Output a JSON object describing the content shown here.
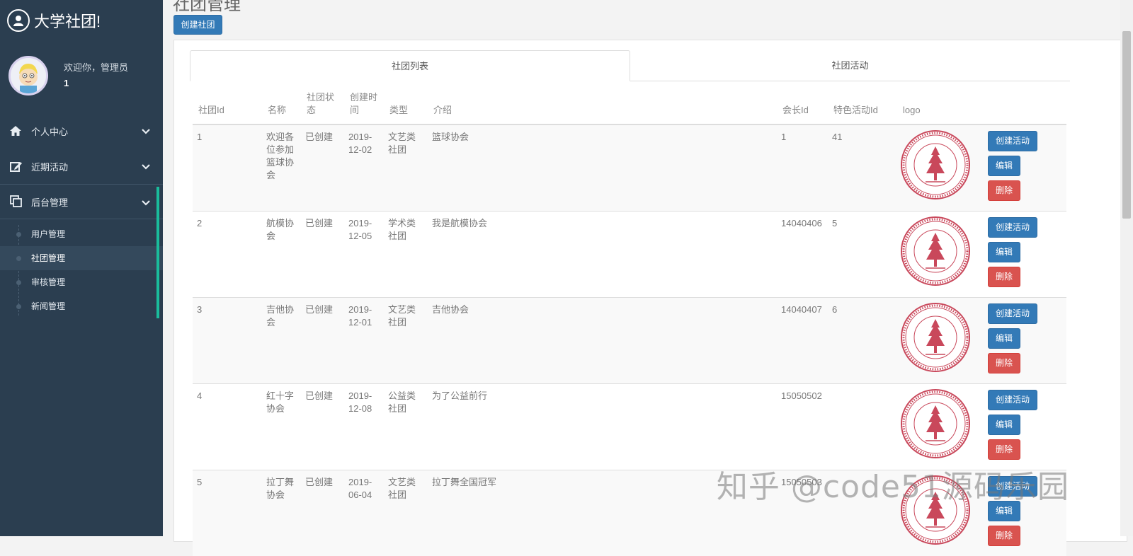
{
  "brand": {
    "title": "大学社团!"
  },
  "user": {
    "welcome": "欢迎你，管理员",
    "id": "1"
  },
  "menu": [
    {
      "label": "个人中心",
      "icon": "home-icon"
    },
    {
      "label": "近期活动",
      "icon": "edit-icon"
    },
    {
      "label": "后台管理",
      "icon": "copy-icon"
    }
  ],
  "submenu": [
    "用户管理",
    "社团管理",
    "审核管理",
    "新闻管理"
  ],
  "page": {
    "title": "社团管理",
    "create_button": "创建社团"
  },
  "tabs": {
    "list": "社团列表",
    "activities": "社团活动"
  },
  "table": {
    "headers": [
      "社团Id",
      "名称",
      "社团状态",
      "创建时间",
      "类型",
      "介绍",
      "会长Id",
      "特色活动Id",
      "logo"
    ],
    "rows": [
      {
        "id": "1",
        "name": "欢迎各位参加篮球协会",
        "status": "已创建",
        "created": "2019-12-02",
        "type": "文艺类社团",
        "intro": "篮球协会",
        "president": "1",
        "activity": "41"
      },
      {
        "id": "2",
        "name": "航模协会",
        "status": "已创建",
        "created": "2019-12-05",
        "type": "学术类社团",
        "intro": "我是航模协会",
        "president": "14040406",
        "activity": "5"
      },
      {
        "id": "3",
        "name": "吉他协会",
        "status": "已创建",
        "created": "2019-12-01",
        "type": "文艺类社团",
        "intro": "吉他协会",
        "president": "14040407",
        "activity": "6"
      },
      {
        "id": "4",
        "name": "红十字协会",
        "status": "已创建",
        "created": "2019-12-08",
        "type": "公益类社团",
        "intro": "为了公益前行",
        "president": "15050502",
        "activity": ""
      },
      {
        "id": "5",
        "name": "拉丁舞协会",
        "status": "已创建",
        "created": "2019-06-04",
        "type": "文艺类社团",
        "intro": "拉丁舞全国冠军",
        "president": "15050503",
        "activity": ""
      }
    ],
    "actions": {
      "create": "创建活动",
      "edit": "编辑",
      "delete": "删除"
    }
  },
  "watermark": "知乎 @code51源码乐园",
  "colors": {
    "sidebar": "#2b3e50",
    "accent": "#1abc9c",
    "primary": "#337ab7",
    "danger": "#d9534f",
    "seal": "#c9485b"
  }
}
